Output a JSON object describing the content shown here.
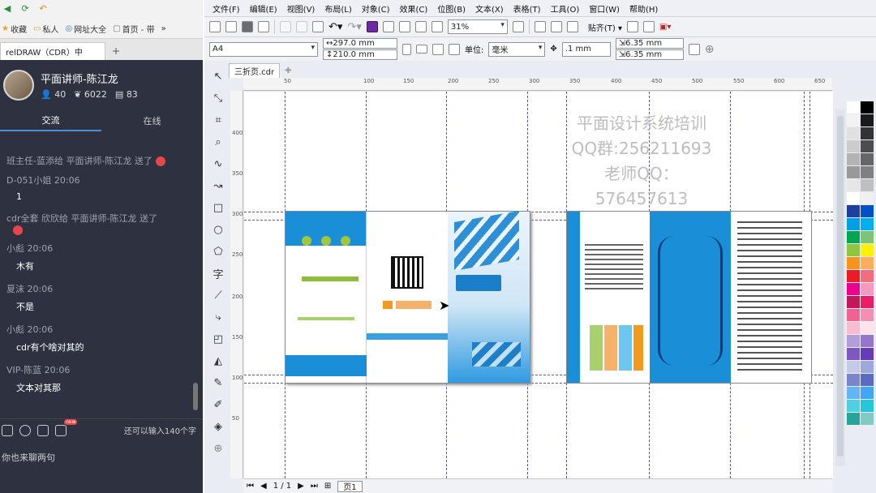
{
  "browser": {
    "favorites": [
      "收藏",
      "私人",
      "网址大全",
      "首页 - 带"
    ],
    "tab_title": "relDRAW（CDR）中",
    "new_tab_symbol": "+"
  },
  "profile": {
    "name": "平面讲师-陈江龙",
    "stats": [
      "40",
      "6022",
      "83"
    ]
  },
  "chat_tabs": [
    "交流",
    "在线"
  ],
  "chat": [
    {
      "meta": "班主任-蓝添给 平面讲师-陈江龙 送了",
      "text": "",
      "gift": true
    },
    {
      "meta": "D-051小姐 20:06",
      "text": "1"
    },
    {
      "meta": "cdr全套 欣欣给 平面讲师-陈江龙 送了",
      "text": "",
      "gift": true
    },
    {
      "meta": "小彪 20:06",
      "text": "木有"
    },
    {
      "meta": "夏沫 20:06",
      "text": "不是"
    },
    {
      "meta": "小彪 20:06",
      "text": "cdr有个啥对其的"
    },
    {
      "meta": "VIP-陈蓝 20:06",
      "text": "文本对其那"
    }
  ],
  "chat_footer": {
    "new_badge": "new",
    "limit": "还可以输入140个字",
    "input_placeholder": "你也来聊两句"
  },
  "menu": [
    "文件(F)",
    "编辑(E)",
    "视图(V)",
    "布局(L)",
    "对象(C)",
    "效果(C)",
    "位图(B)",
    "文本(X)",
    "表格(T)",
    "工具(O)",
    "窗口(W)",
    "帮助(H)"
  ],
  "toolbar": {
    "zoom": "31%",
    "snap": "贴齐(T)",
    "page_size": "A4",
    "width": "297.0 mm",
    "height": "210.0 mm",
    "unit_label": "单位:",
    "unit": "毫米",
    "nudge": ".1 mm",
    "dup_x": "6.35 mm",
    "dup_y": "6.35 mm"
  },
  "document": {
    "tab": "三折页.cdr"
  },
  "ruler_h": [
    "50",
    "100",
    "150",
    "200",
    "250",
    "300",
    "350",
    "400",
    "450",
    "500",
    "550",
    "600",
    "650"
  ],
  "ruler_v": [
    "400",
    "350",
    "300",
    "250",
    "200",
    "150",
    "100",
    "50"
  ],
  "watermark": [
    "平面设计系统培训",
    "QQ群:256211693",
    "老师QQ：576457613"
  ],
  "status": {
    "page_count": "1 / 1",
    "page_tab": "页1"
  },
  "colors": {
    "accent": "#4a90d9",
    "sidebar": "#2e3240",
    "brochure_blue": "#1a8fd8"
  }
}
